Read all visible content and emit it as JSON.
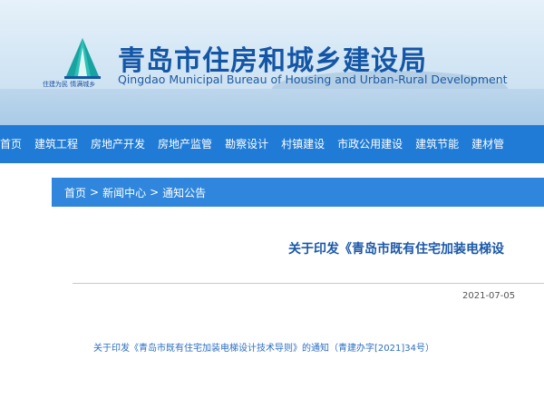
{
  "header": {
    "title_cn": "青岛市住房和城乡建设局",
    "title_en": "Qingdao Municipal Bureau of Housing and Urban-Rural Development",
    "slogan": "住建为民 情满城乡"
  },
  "nav": {
    "items": [
      "站首页",
      "建筑工程",
      "房地产开发",
      "房地产监管",
      "勘察设计",
      "村镇建设",
      "市政公用建设",
      "建筑节能",
      "建材管"
    ]
  },
  "breadcrumb": {
    "home": "首页",
    "news": "新闻中心",
    "notice": "通知公告",
    "separator": ">"
  },
  "article": {
    "title": "关于印发《青岛市既有住宅加装电梯设",
    "date": "2021-07-05",
    "attachment_link": "关于印发《青岛市既有住宅加装电梯设计技术导则》的通知（青建办字[2021]34号）"
  },
  "colors": {
    "nav_bg": "#1f7bd6",
    "breadcrumb_bg": "#2f86dc",
    "title_blue": "#1456a6"
  }
}
